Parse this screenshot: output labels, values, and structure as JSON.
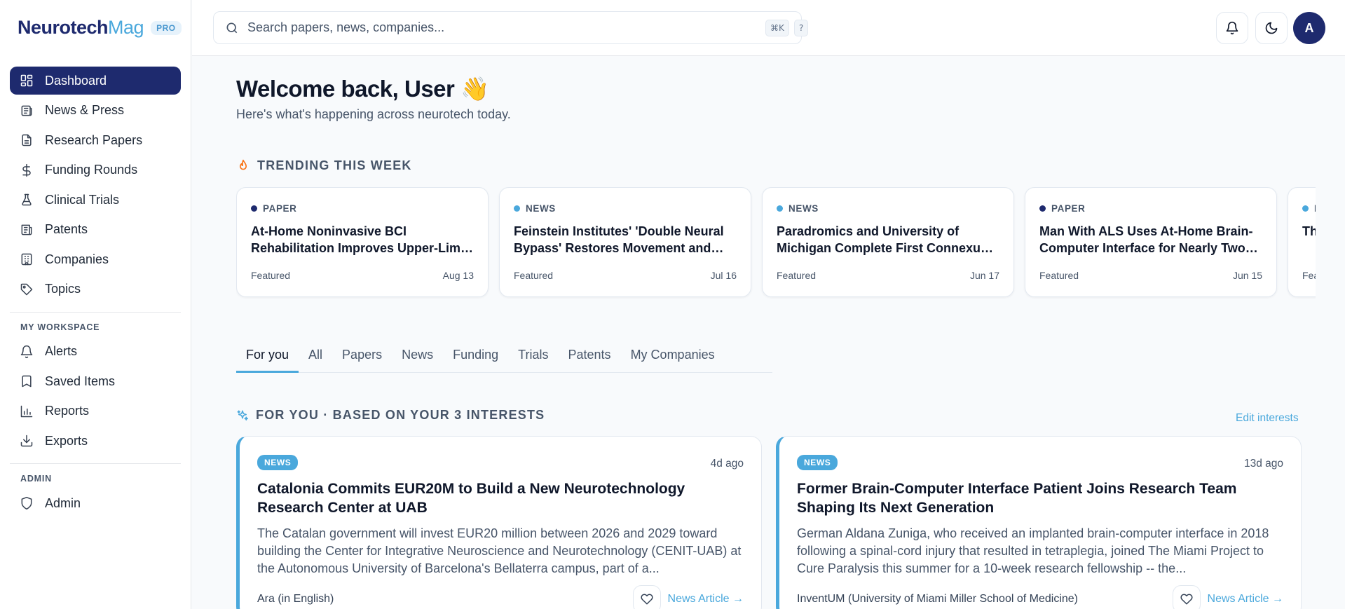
{
  "brand": {
    "name_part1": "Neurotech",
    "name_part2": "Mag",
    "badge": "PRO"
  },
  "sidebar": {
    "items": [
      {
        "label": "Dashboard",
        "icon": "dashboard-icon",
        "active": true
      },
      {
        "label": "News & Press",
        "icon": "newspaper-icon"
      },
      {
        "label": "Research Papers",
        "icon": "document-icon"
      },
      {
        "label": "Funding Rounds",
        "icon": "dollar-icon"
      },
      {
        "label": "Clinical Trials",
        "icon": "flask-icon"
      },
      {
        "label": "Patents",
        "icon": "patent-icon"
      },
      {
        "label": "Companies",
        "icon": "building-icon"
      },
      {
        "label": "Topics",
        "icon": "tag-icon"
      }
    ],
    "workspace_title": "MY WORKSPACE",
    "workspace_items": [
      {
        "label": "Alerts",
        "icon": "bell-icon"
      },
      {
        "label": "Saved Items",
        "icon": "bookmark-icon"
      },
      {
        "label": "Reports",
        "icon": "bar-chart-icon"
      },
      {
        "label": "Exports",
        "icon": "download-icon"
      }
    ],
    "admin_title": "ADMIN",
    "admin_items": [
      {
        "label": "Admin",
        "icon": "shield-icon"
      }
    ]
  },
  "topbar": {
    "search_placeholder": "Search papers, news, companies...",
    "shortcut": "⌘K",
    "help_key": "?",
    "avatar_initial": "A"
  },
  "main": {
    "welcome": "Welcome back, User 👋",
    "subtitle": "Here's what's happening across neurotech today.",
    "trending_title": "TRENDING THIS WEEK",
    "trending": [
      {
        "type": "PAPER",
        "title": "At-Home Noninvasive BCI Rehabilitation Improves Upper-Limb Function",
        "tag": "Featured",
        "date": "Aug 13"
      },
      {
        "type": "NEWS",
        "title": "Feinstein Institutes' 'Double Neural Bypass' Restores Movement and Sensation",
        "tag": "Featured",
        "date": "Jul 16"
      },
      {
        "type": "NEWS",
        "title": "Paradromics and University of Michigan Complete First Connexus Implant",
        "tag": "Featured",
        "date": "Jun 17"
      },
      {
        "type": "PAPER",
        "title": "Man With ALS Uses At-Home Brain-Computer Interface for Nearly Two Years",
        "tag": "Featured",
        "date": "Jun 15"
      },
      {
        "type": "NEWS",
        "title": "The Us",
        "tag": "Featured",
        "date": ""
      }
    ],
    "tabs": [
      "For you",
      "All",
      "Papers",
      "News",
      "Funding",
      "Trials",
      "Patents",
      "My Companies"
    ],
    "active_tab": "For you",
    "for_you_title": "FOR YOU · BASED ON YOUR 3 INTERESTS",
    "edit_interests": "Edit interests",
    "articles": [
      {
        "badge": "NEWS",
        "time": "4d ago",
        "title": "Catalonia Commits EUR20M to Build a New Neurotechnology Research Center at UAB",
        "body": "The Catalan government will invest EUR20 million between 2026 and 2029 toward building the Center for Integrative Neuroscience and Neurotechnology (CENIT-UAB) at the Autonomous University of Barcelona's Bellaterra campus, part of a...",
        "source": "Ara (in English)",
        "link": "News Article →"
      },
      {
        "badge": "NEWS",
        "time": "13d ago",
        "title": "Former Brain-Computer Interface Patient Joins Research Team Shaping Its Next Generation",
        "body": "German Aldana Zuniga, who received an implanted brain-computer interface in 2018 following a spinal-cord injury that resulted in tetraplegia, joined The Miami Project to Cure Paralysis this summer for a 10-week research fellowship -- the...",
        "source": "InventUM (University of Miami Miller School of Medicine)",
        "link": "News Article →"
      }
    ]
  },
  "colors": {
    "navy": "#1e2a6e",
    "accent": "#4aa8dc",
    "flame": "#f97316"
  }
}
